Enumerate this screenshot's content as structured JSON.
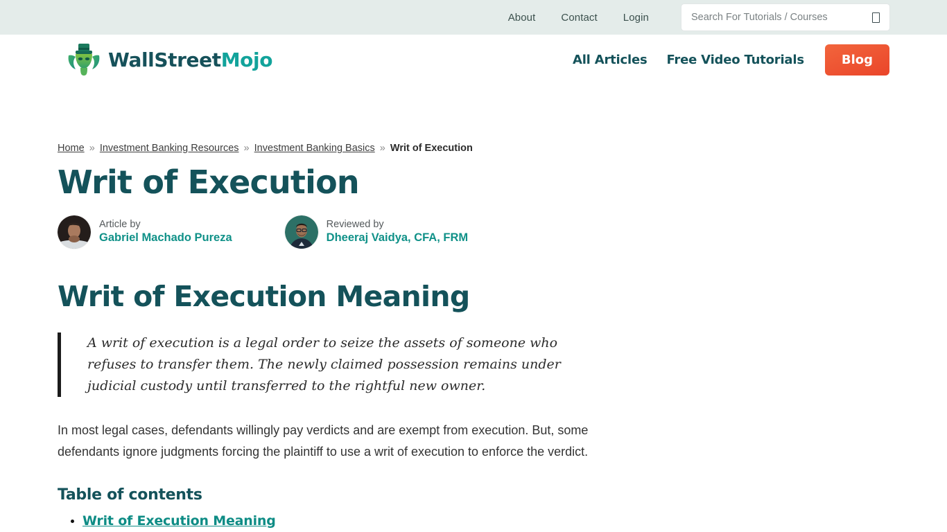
{
  "topbar": {
    "links": [
      {
        "label": "About"
      },
      {
        "label": "Contact"
      },
      {
        "label": "Login"
      }
    ],
    "search": {
      "placeholder": "Search For Tutorials / Courses",
      "value": "",
      "icon": "search-icon-missing-glyph"
    },
    "background_color": "#e4ecea"
  },
  "header": {
    "brand": {
      "name_part1": "WallStreet",
      "name_part2": "Mojo",
      "logo_icon": "bull-with-top-hat-logo",
      "color_part1": "#16515a",
      "color_part2": "#12a39b"
    },
    "nav": [
      {
        "label": "All Articles"
      },
      {
        "label": "Free Video Tutorials"
      }
    ],
    "cta": {
      "label": "Blog",
      "color": "#ea452a"
    }
  },
  "article": {
    "breadcrumb": {
      "items": [
        {
          "label": "Home",
          "is_link": true
        },
        {
          "label": "Investment Banking Resources",
          "is_link": true
        },
        {
          "label": "Investment Banking Basics",
          "is_link": true
        },
        {
          "label": "Writ of Execution",
          "is_link": false
        }
      ],
      "separator": "»"
    },
    "title": "Writ of Execution",
    "bylines": [
      {
        "role": "Article by",
        "name": "Gabriel Machado Pureza",
        "avatar": "author-avatar-photo"
      },
      {
        "role": "Reviewed by",
        "name": "Dheeraj Vaidya, CFA, FRM",
        "avatar": "reviewer-avatar-photo"
      }
    ],
    "section_heading": "Writ of Execution Meaning",
    "quote": "A writ of execution is a legal order to seize the assets of someone who refuses to transfer them. The newly claimed possession remains under judicial custody until transferred to the rightful new owner.",
    "paragraph": "In most legal cases, defendants willingly pay verdicts and are exempt from execution. But,  some defendants ignore judgments forcing the plaintiff to use a writ of execution to enforce the verdict.",
    "toc": {
      "title": "Table of contents",
      "items": [
        {
          "label": "Writ of Execution Meaning"
        }
      ]
    },
    "accent_color": "#14525a",
    "link_color": "#0e8c85"
  }
}
